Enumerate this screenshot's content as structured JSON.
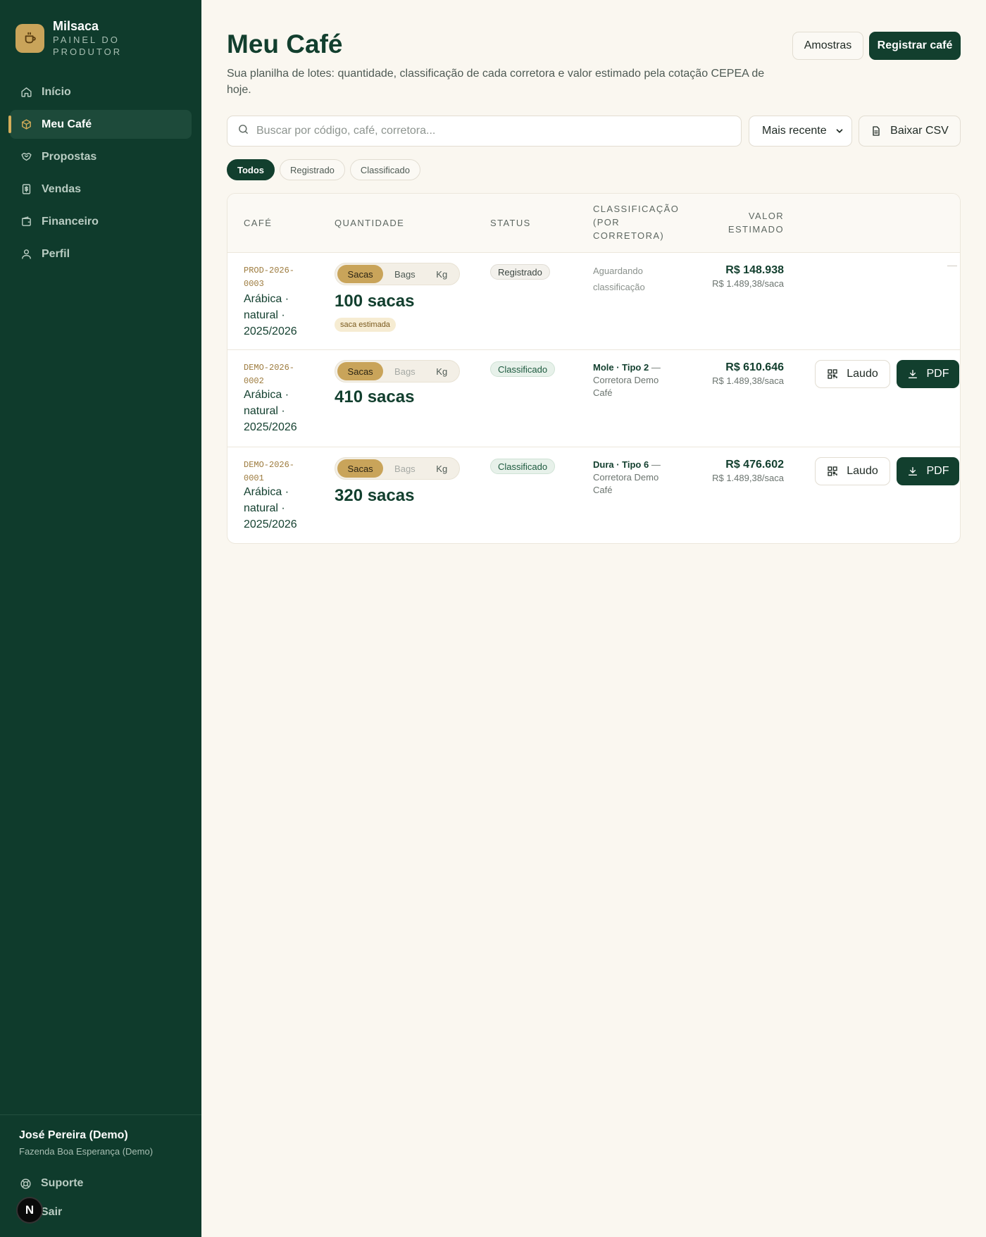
{
  "sidebar": {
    "brand_name": "Milsaca",
    "brand_subtitle": "PAINEL DO PRODUTOR",
    "nav": [
      {
        "label": "Início",
        "icon": "home-icon"
      },
      {
        "label": "Meu Café",
        "icon": "box-icon"
      },
      {
        "label": "Propostas",
        "icon": "handshake-icon"
      },
      {
        "label": "Vendas",
        "icon": "receipt-icon"
      },
      {
        "label": "Financeiro",
        "icon": "wallet-icon"
      },
      {
        "label": "Perfil",
        "icon": "user-icon"
      }
    ],
    "active_item": "Meu Café",
    "user_name": "José Pereira (Demo)",
    "user_farm": "Fazenda Boa Esperança (Demo)",
    "support_label": "Suporte",
    "logout_label": "Sair",
    "badge_letter": "N"
  },
  "header": {
    "title": "Meu Café",
    "description": "Sua planilha de lotes: quantidade, classificação de cada corretora e valor estimado pela cotação CEPEA de hoje.",
    "samples_button": "Amostras",
    "register_button": "Registrar café"
  },
  "toolbar": {
    "search_placeholder": "Buscar por código, café, corretora...",
    "sort_selected": "Mais recente",
    "csv_button": "Baixar CSV"
  },
  "filters": [
    "Todos",
    "Registrado",
    "Classificado"
  ],
  "active_filter": "Todos",
  "table": {
    "headers": {
      "cafe": "CAFÉ",
      "quantidade": "QUANTIDADE",
      "status": "STATUS",
      "classificacao_line1": "CLASSIFICAÇÃO",
      "classificacao_line2": "(POR",
      "classificacao_line3": "CORRETORA)",
      "valor_line1": "VALOR",
      "valor_line2": "ESTIMADO"
    },
    "unit_options": [
      "Sacas",
      "Bags",
      "Kg"
    ],
    "rows": [
      {
        "code_line1": "PROD-2026-",
        "code_line2": "0003",
        "coffee_line1": "Arábica ·",
        "coffee_line2": "natural ·",
        "coffee_line3": "2025/2026",
        "selected_unit": "Sacas",
        "quantity": "100 sacas",
        "estimate_tag": "saca estimada",
        "status": "Registrado",
        "classification_line1": "Aguardando",
        "classification_line2": "classificação",
        "value": "R$ 148.938",
        "value_per": "R$ 1.489,38/saca",
        "actions": "—"
      },
      {
        "code_line1": "DEMO-2026-",
        "code_line2": "0002",
        "coffee_line1": "Arábica ·",
        "coffee_line2": "natural ·",
        "coffee_line3": "2025/2026",
        "selected_unit": "Sacas",
        "quantity": "410 sacas",
        "status": "Classificado",
        "classification_bold": "Mole · Tipo 2",
        "classification_rest": " — Corretora Demo Café",
        "value": "R$ 610.646",
        "value_per": "R$ 1.489,38/saca",
        "laudo_button": "Laudo",
        "pdf_button": "PDF"
      },
      {
        "code_line1": "DEMO-2026-",
        "code_line2": "0001",
        "coffee_line1": "Arábica ·",
        "coffee_line2": "natural ·",
        "coffee_line3": "2025/2026",
        "selected_unit": "Sacas",
        "quantity": "320 sacas",
        "status": "Classificado",
        "classification_bold": "Dura · Tipo 6",
        "classification_rest": " — Corretora Demo Café",
        "value": "R$ 476.602",
        "value_per": "R$ 1.489,38/saca",
        "laudo_button": "Laudo",
        "pdf_button": "PDF"
      }
    ]
  },
  "colors": {
    "sidebar_bg": "#0f3b2c",
    "brand_accent": "#c9a45a",
    "primary": "#123f2e",
    "page_bg": "#faf7f0"
  }
}
